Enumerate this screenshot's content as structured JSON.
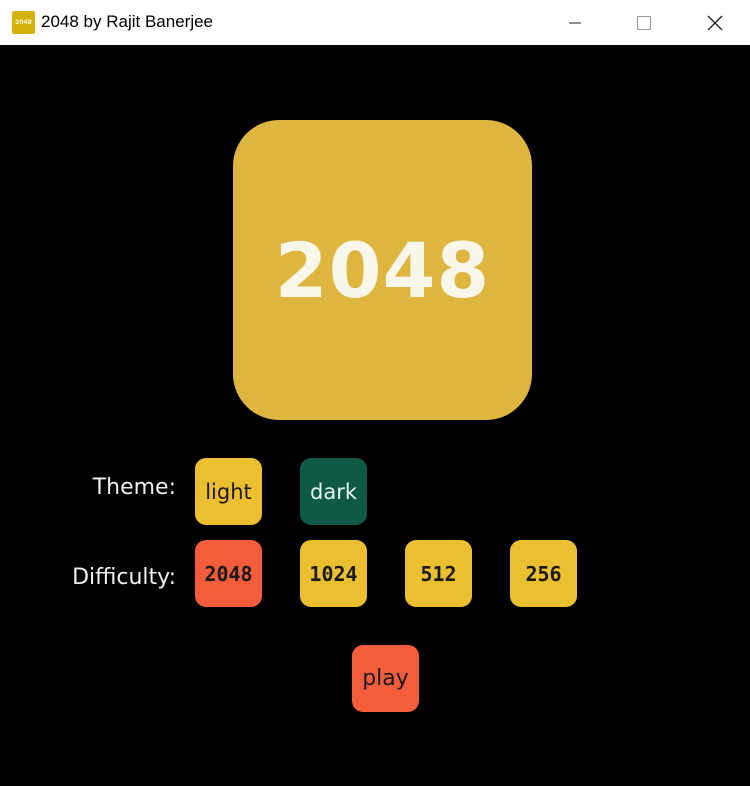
{
  "window": {
    "title": "2048 by Rajit Banerjee",
    "icon_text": "2048",
    "controls": [
      "minimize-icon",
      "maximize-icon",
      "close-icon"
    ]
  },
  "logo": {
    "text": "2048",
    "color": "#deb53e"
  },
  "theme": {
    "label": "Theme:",
    "options": [
      {
        "label": "light",
        "color": "#ecbf30"
      },
      {
        "label": "dark",
        "color": "#0e5a46"
      }
    ]
  },
  "difficulty": {
    "label": "Difficulty:",
    "options": [
      {
        "label": "2048",
        "color": "#f35d3c"
      },
      {
        "label": "1024",
        "color": "#ecbf30"
      },
      {
        "label": "512",
        "color": "#ecbf30"
      },
      {
        "label": "256",
        "color": "#ecbf30"
      }
    ]
  },
  "play": {
    "label": "play",
    "color": "#f35d3c"
  }
}
